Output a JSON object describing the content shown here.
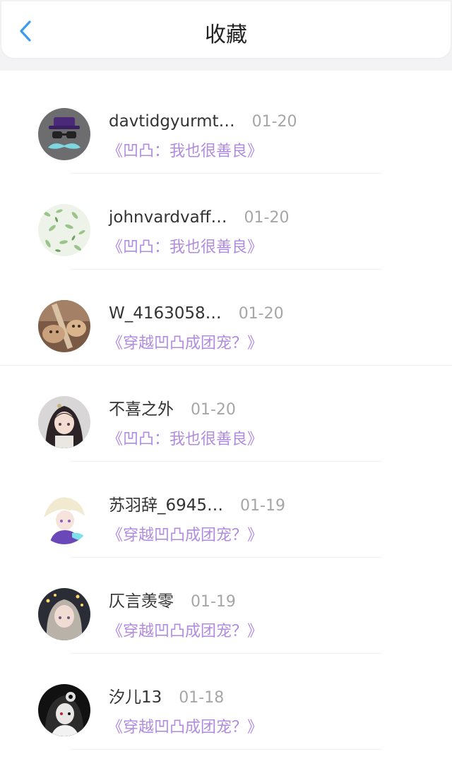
{
  "header": {
    "title": "收藏",
    "back_icon": "chevron-left-icon",
    "accent_color": "#3a9bf0"
  },
  "items": [
    {
      "username": "davtidgyurmt…",
      "date": "01-20",
      "book": "《凹凸：我也很善良》",
      "avatar": "mustache-hat-avatar"
    },
    {
      "username": "johnvardvaff…",
      "date": "01-20",
      "book": "《凹凸：我也很善良》",
      "avatar": "leaf-pattern-avatar"
    },
    {
      "username": "W_4163058…",
      "date": "01-20",
      "book": "《穿越凹凸成团宠？》",
      "avatar": "cats-photo-avatar"
    },
    {
      "username": "不喜之外",
      "date": "01-20",
      "book": "《凹凸：我也很善良》",
      "avatar": "anime-girl-avatar"
    },
    {
      "username": "苏羽辞_6945…",
      "date": "01-19",
      "book": "《穿越凹凸成团宠？》",
      "avatar": "anime-boy-avatar"
    },
    {
      "username": "仄言羡零",
      "date": "01-19",
      "book": "《穿越凹凸成团宠？》",
      "avatar": "anime-girl-lights-avatar"
    },
    {
      "username": "汐儿13",
      "date": "01-18",
      "book": "《穿越凹凸成团宠？》",
      "avatar": "dark-anime-avatar"
    }
  ],
  "colors": {
    "link": "#b08be0",
    "date": "#a6a6a6",
    "username": "#333333"
  }
}
